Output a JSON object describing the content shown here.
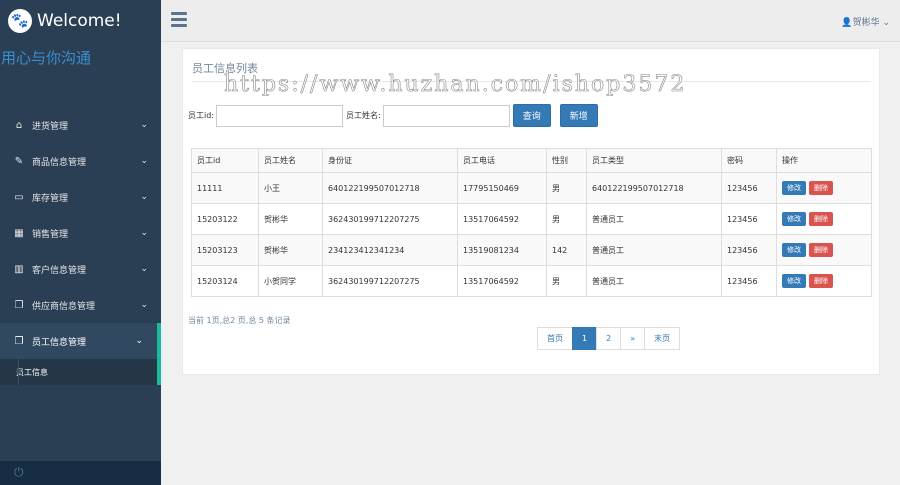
{
  "brand": {
    "name": "Welcome!",
    "slogan": "用心与你沟通"
  },
  "sidebar": {
    "items": [
      {
        "label": "进货管理",
        "icon": "home-icon"
      },
      {
        "label": "商品信息管理",
        "icon": "edit-icon"
      },
      {
        "label": "库存管理",
        "icon": "desktop-icon"
      },
      {
        "label": "销售管理",
        "icon": "table-icon"
      },
      {
        "label": "客户信息管理",
        "icon": "bar-chart-icon"
      },
      {
        "label": "供应商信息管理",
        "icon": "copy-icon"
      },
      {
        "label": "员工信息管理",
        "icon": "copy-icon"
      }
    ],
    "sub_item": "员工信息"
  },
  "topbar": {
    "user": "贺彬华"
  },
  "panel": {
    "title": "员工信息列表"
  },
  "watermark": "https://www.huzhan.com/ishop3572",
  "search": {
    "id_label": "员工id:",
    "name_label": "员工姓名:",
    "query_button": "查询",
    "add_button": "新增"
  },
  "table": {
    "headers": [
      "员工id",
      "员工姓名",
      "身份证",
      "员工电话",
      "性别",
      "员工类型",
      "密码",
      "操作"
    ],
    "rows": [
      [
        "11111",
        "小王",
        "640122199507012718",
        "17795150469",
        "男",
        "640122199507012718",
        "123456"
      ],
      [
        "15203122",
        "贺彬华",
        "362430199712207275",
        "13517064592",
        "男",
        "普通员工",
        "123456"
      ],
      [
        "15203123",
        "贺彬华",
        "234123412341234",
        "13519081234",
        "142",
        "普通员工",
        "123456"
      ],
      [
        "15203124",
        "小贺同学",
        "362430199712207275",
        "13517064592",
        "男",
        "普通员工",
        "123456"
      ]
    ],
    "edit_label": "修改",
    "delete_label": "删除"
  },
  "records": "当前 1页,总2 页,总 5 条记录",
  "pagination": [
    "首页",
    "1",
    "2",
    "»",
    "末页"
  ],
  "colors": {
    "sidebar": "#2a3f54",
    "accent": "#1abb9c",
    "primary": "#337ab7",
    "danger": "#d9534f"
  }
}
